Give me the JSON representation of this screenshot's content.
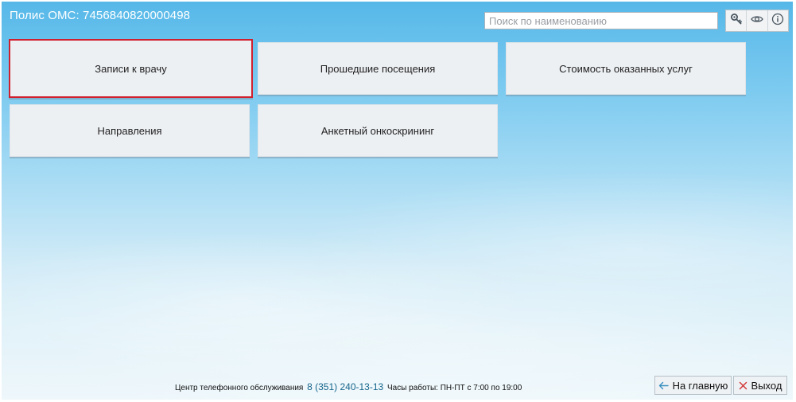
{
  "header": {
    "policy_label": "Полис ОМС: 7456840820000498"
  },
  "search": {
    "placeholder": "Поиск по наименованию",
    "value": ""
  },
  "toolbar": {
    "icons": [
      "key-icon",
      "eye-icon",
      "info-icon"
    ]
  },
  "tiles": [
    {
      "label": "Записи к врачу",
      "selected": true
    },
    {
      "label": "Прошедшие посещения",
      "selected": false
    },
    {
      "label": "Стоимость оказанных услуг",
      "selected": false
    },
    {
      "label": "Направления",
      "selected": false
    },
    {
      "label": "Анкетный онкоскрининг",
      "selected": false
    }
  ],
  "footer": {
    "service_center": "Центр телефонного обслуживания",
    "phone": "8 (351) 240-13-13",
    "hours": "Часы работы: ПН-ПТ с 7:00 по 19:00",
    "home_label": "На главную",
    "exit_label": "Выход"
  },
  "colors": {
    "selected_border": "#d0202e",
    "phone_color": "#15658c",
    "exit_icon": "#d23b3b",
    "home_icon": "#3a8fc0"
  }
}
